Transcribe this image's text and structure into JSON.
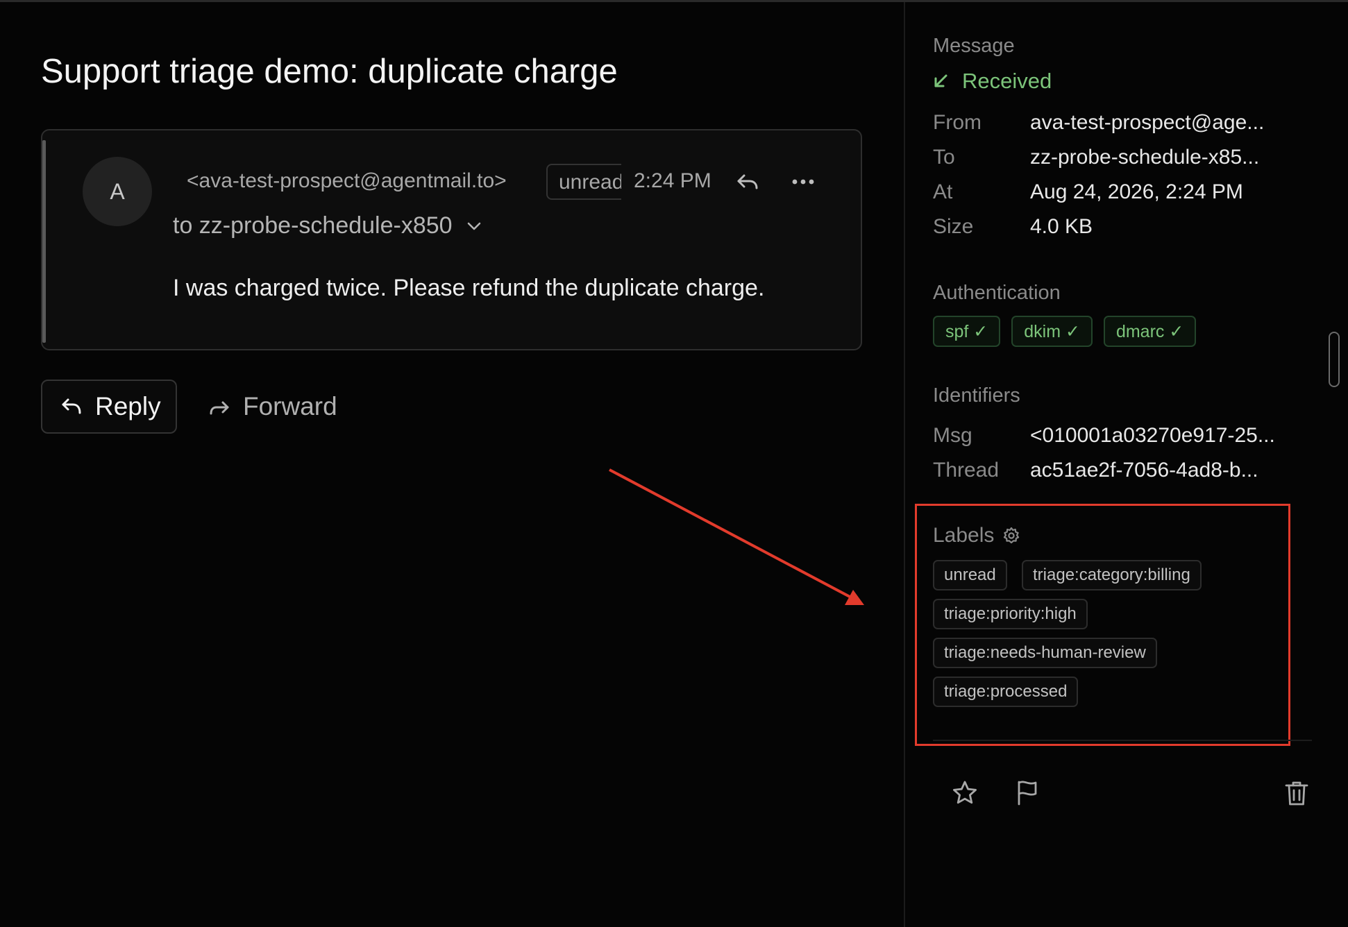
{
  "message": {
    "subject": "Support triage demo: duplicate charge",
    "avatar_initial": "A",
    "sender": "<ava-test-prospect@agentmail.to>",
    "status_badge": "unread",
    "time": "2:24 PM",
    "recipient": "to zz-probe-schedule-x850",
    "body": "I was charged twice. Please refund the duplicate charge."
  },
  "actions": {
    "reply_label": "Reply",
    "forward_label": "Forward"
  },
  "sidebar": {
    "message_section": "Message",
    "direction": "Received",
    "meta": [
      {
        "key": "From",
        "value": "ava-test-prospect@age..."
      },
      {
        "key": "To",
        "value": "zz-probe-schedule-x85..."
      },
      {
        "key": "At",
        "value": "Aug 24, 2026, 2:24 PM"
      },
      {
        "key": "Size",
        "value": "4.0 KB"
      }
    ],
    "auth_section": "Authentication",
    "auth": [
      "spf ✓",
      "dkim ✓",
      "dmarc ✓"
    ],
    "ids_section": "Identifiers",
    "ids": [
      {
        "key": "Msg",
        "value": "<010001a03270e917-25..."
      },
      {
        "key": "Thread",
        "value": "ac51ae2f-7056-4ad8-b..."
      }
    ],
    "labels_section": "Labels",
    "labels": [
      "unread",
      "triage:category:billing",
      "triage:priority:high",
      "triage:needs-human-review",
      "triage:processed"
    ]
  },
  "icons": {
    "direction": "arrow-down-left-icon",
    "labels_settings": "gear-icon",
    "star": "star-icon",
    "flag": "flag-icon",
    "trash": "trash-icon",
    "reply": "reply-icon",
    "forward": "forward-icon",
    "more": "more-horizontal-icon",
    "expand": "chevron-down-icon"
  },
  "colors": {
    "background": "#050505",
    "success": "#7cc47a",
    "annotation": "#e23b2c"
  }
}
